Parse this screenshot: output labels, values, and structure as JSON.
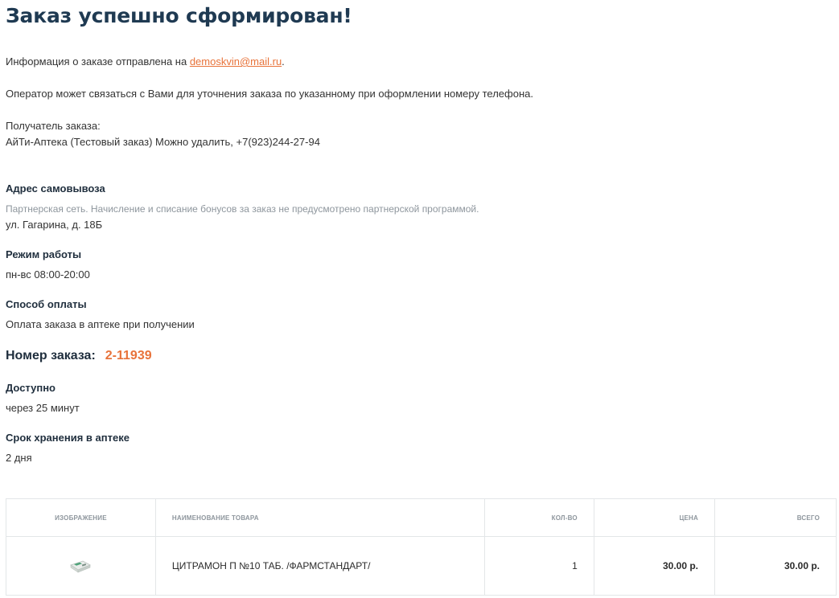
{
  "page": {
    "title": "Заказ успешно сформирован!"
  },
  "info": {
    "email_prefix": "Информация о заказе отправлена на ",
    "email": "demoskvin@mail.ru",
    "email_suffix": ".",
    "operator_text": "Оператор может связаться с Вами для уточнения заказа по указанному при оформлении номеру телефона.",
    "recipient_label": "Получатель заказа:",
    "recipient_value": "АйТи-Аптека (Тестовый заказ) Можно удалить, +7(923)244-27-94"
  },
  "pickup": {
    "label": "Адрес самовывоза",
    "note": "Партнерская сеть. Начисление и списание бонусов за заказ не предусмотрено партнерской программой.",
    "address": "ул. Гагарина, д. 18Б"
  },
  "schedule": {
    "label": "Режим работы",
    "value": "пн-вс 08:00-20:00"
  },
  "payment": {
    "label": "Способ оплаты",
    "value": "Оплата заказа в аптеке при получении"
  },
  "order": {
    "number_label": "Номер заказа:",
    "number_value": "2-11939"
  },
  "availability": {
    "label": "Доступно",
    "value": "через 25 минут"
  },
  "storage": {
    "label": "Срок хранения в аптеке",
    "value": "2 дня"
  },
  "table": {
    "headers": {
      "image": "Изображение",
      "name": "Наименование товара",
      "qty": "Кол-во",
      "price": "Цена",
      "total": "Всего"
    },
    "rows": [
      {
        "name": "ЦИТРАМОН П №10 ТАБ. /ФАРМСТАНДАРТ/",
        "qty": "1",
        "price": "30.00 р.",
        "total": "30.00 р.",
        "image_icon": "medicine-package-icon"
      }
    ]
  },
  "colors": {
    "title": "#1f3a52",
    "accent": "#e8733a",
    "muted": "#8e969d",
    "border": "#e3e6e8"
  }
}
